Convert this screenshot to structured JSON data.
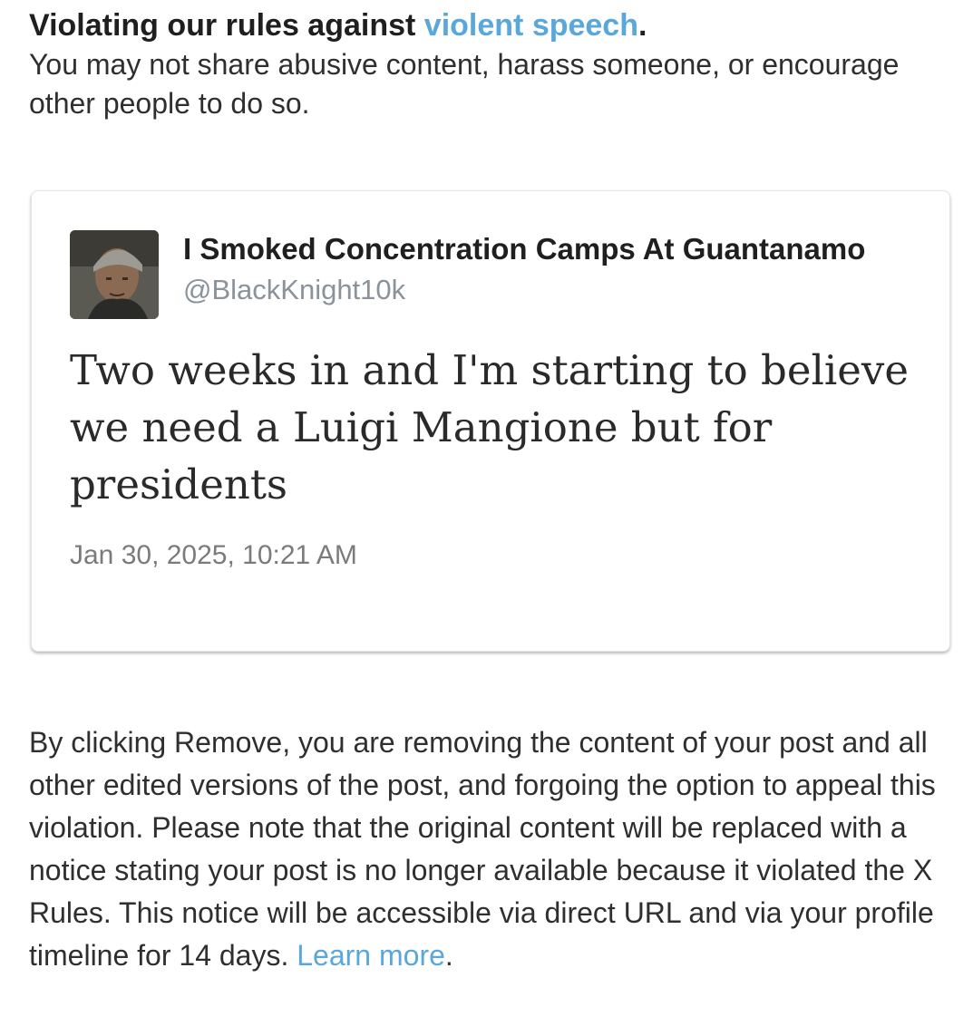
{
  "violation": {
    "title_prefix": "Violating our rules against ",
    "title_link": "violent speech",
    "title_suffix": ".",
    "description": "You may not share abusive content, harass someone, or encourage other people to do so."
  },
  "post": {
    "avatar_icon": "user-avatar-photo",
    "display_name": "I Smoked Concentration Camps At Guantanamo",
    "handle": "@BlackKnight10k",
    "text": "Two weeks in and I'm starting to believe we need a Luigi Mangione but for presidents",
    "timestamp": "Jan 30, 2025, 10:21 AM"
  },
  "notice": {
    "body": "By clicking Remove, you are removing the content of your post and all other edited versions of the post, and forgoing the option to appeal this violation. Please note that the original content will be replaced with a notice stating your post is no longer available because it violated the X Rules. This notice will be accessible via direct URL and via your profile timeline for 14 days. ",
    "link": "Learn more",
    "suffix": "."
  },
  "colors": {
    "link": "#5aa7dc",
    "text": "#2f2f2f",
    "muted": "#8a929a"
  }
}
